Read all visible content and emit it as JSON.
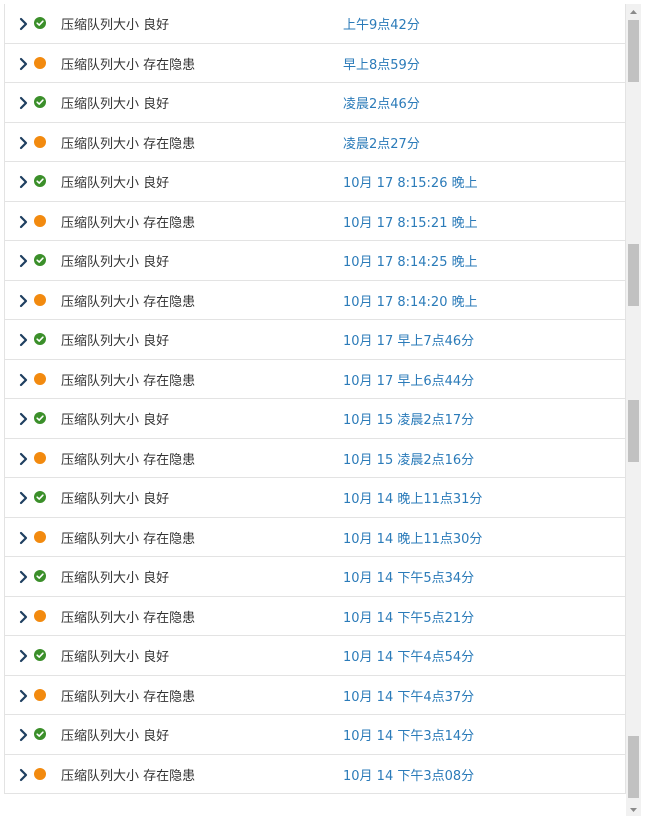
{
  "colors": {
    "good": "#3b8f2a",
    "warn": "#f28a0f",
    "link": "#2b7bb9",
    "text": "#333333",
    "chevron": "#1f3f60"
  },
  "rows": [
    {
      "status": "good",
      "name": "压缩队列大小 良好",
      "time": "上午9点42分"
    },
    {
      "status": "warn",
      "name": "压缩队列大小 存在隐患",
      "time": "早上8点59分"
    },
    {
      "status": "good",
      "name": "压缩队列大小 良好",
      "time": "凌晨2点46分"
    },
    {
      "status": "warn",
      "name": "压缩队列大小 存在隐患",
      "time": "凌晨2点27分"
    },
    {
      "status": "good",
      "name": "压缩队列大小 良好",
      "time": "10月 17 8:15:26 晚上"
    },
    {
      "status": "warn",
      "name": "压缩队列大小 存在隐患",
      "time": "10月 17 8:15:21 晚上"
    },
    {
      "status": "good",
      "name": "压缩队列大小 良好",
      "time": "10月 17 8:14:25 晚上"
    },
    {
      "status": "warn",
      "name": "压缩队列大小 存在隐患",
      "time": "10月 17 8:14:20 晚上"
    },
    {
      "status": "good",
      "name": "压缩队列大小 良好",
      "time": "10月 17 早上7点46分"
    },
    {
      "status": "warn",
      "name": "压缩队列大小 存在隐患",
      "time": "10月 17 早上6点44分"
    },
    {
      "status": "good",
      "name": "压缩队列大小 良好",
      "time": "10月 15 凌晨2点17分"
    },
    {
      "status": "warn",
      "name": "压缩队列大小 存在隐患",
      "time": "10月 15 凌晨2点16分"
    },
    {
      "status": "good",
      "name": "压缩队列大小 良好",
      "time": "10月 14 晚上11点31分"
    },
    {
      "status": "warn",
      "name": "压缩队列大小 存在隐患",
      "time": "10月 14 晚上11点30分"
    },
    {
      "status": "good",
      "name": "压缩队列大小 良好",
      "time": "10月 14 下午5点34分"
    },
    {
      "status": "warn",
      "name": "压缩队列大小 存在隐患",
      "time": "10月 14 下午5点21分"
    },
    {
      "status": "good",
      "name": "压缩队列大小 良好",
      "time": "10月 14 下午4点54分"
    },
    {
      "status": "warn",
      "name": "压缩队列大小 存在隐患",
      "time": "10月 14 下午4点37分"
    },
    {
      "status": "good",
      "name": "压缩队列大小 良好",
      "time": "10月 14 下午3点14分"
    },
    {
      "status": "warn",
      "name": "压缩队列大小 存在隐患",
      "time": "10月 14 下午3点08分"
    }
  ],
  "icons": {
    "expand": "chevron-right-icon",
    "good": "check-circle-icon",
    "warn": "warning-dot-icon",
    "scroll_up": "scroll-up-arrow-icon",
    "scroll_down": "scroll-down-arrow-icon"
  }
}
